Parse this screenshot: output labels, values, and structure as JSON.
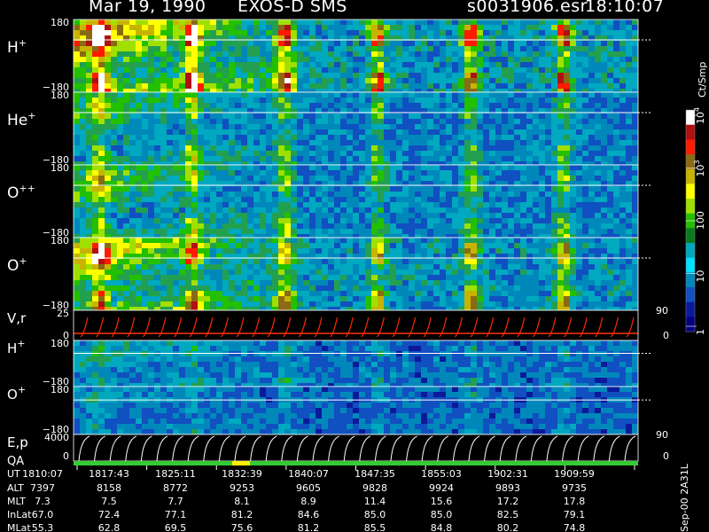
{
  "header": {
    "date": "Mar 19, 1990",
    "mission": "EXOS-D SMS",
    "file": "s0031906.esr",
    "time": "18:10:07"
  },
  "side_label": "Sep-00  2A31L",
  "colorbar": {
    "unit": "Ct/Smp",
    "ticks": [
      {
        "label": "10",
        "sup": "4",
        "value": 10000
      },
      {
        "label": "10",
        "sup": "3",
        "value": 1000
      },
      {
        "label": "100",
        "sup": "",
        "value": 100
      },
      {
        "label": "10",
        "sup": "",
        "value": 10
      },
      {
        "label": "1",
        "sup": "",
        "value": 1
      }
    ],
    "colors": [
      "#ffffff",
      "#b01010",
      "#ff1a00",
      "#8a6a14",
      "#c8b400",
      "#ffff00",
      "#a0e000",
      "#22c000",
      "#0a7a20",
      "#00a8c0",
      "#00e0ff",
      "#0088bb",
      "#1050c0",
      "#0a1a9a",
      "#000080"
    ]
  },
  "panels": [
    {
      "id": "hplus-ang",
      "label": "H",
      "sup": "+",
      "ymax": "180",
      "ymin": "−180",
      "intensity": 1.0
    },
    {
      "id": "heplus-ang",
      "label": "He",
      "sup": "+",
      "ymax": "180",
      "ymin": "−180",
      "intensity": 0.55
    },
    {
      "id": "oplusplus-ang",
      "label": "O",
      "sup": "++",
      "ymax": "180",
      "ymin": "−180",
      "intensity": 0.6
    },
    {
      "id": "oplus-ang",
      "label": "O",
      "sup": "+",
      "ymax": "180",
      "ymin": "−180",
      "intensity": 0.85
    },
    {
      "id": "vr",
      "label": "V",
      "sup": "",
      "label2": ",r",
      "ymax": "25",
      "ymin": "0",
      "right_top": "90",
      "right_bottom": "0"
    },
    {
      "id": "hplus-2",
      "label": "H",
      "sup": "+",
      "ymax": "180",
      "ymin": "−180",
      "intensity": 0.35
    },
    {
      "id": "oplus-2",
      "label": "O",
      "sup": "+",
      "ymax": "180",
      "ymin": "−180",
      "intensity": 0.25
    },
    {
      "id": "ep",
      "label": "E,p",
      "sup": "",
      "ymax": "4000",
      "ymin": "0",
      "right_top": "90",
      "right_bottom": "0"
    }
  ],
  "qa_label": "QA",
  "footer": {
    "rows": [
      {
        "name": "UT",
        "values": [
          "1810:07",
          "1817:43",
          "1825:11",
          "1832:39",
          "1840:07",
          "1847:35",
          "1855:03",
          "1902:31",
          "1909:59"
        ]
      },
      {
        "name": "ALT",
        "values": [
          "7397",
          "8158",
          "8772",
          "9253",
          "9605",
          "9828",
          "9924",
          "9893",
          "9735"
        ]
      },
      {
        "name": "MLT",
        "values": [
          "7.3",
          "7.5",
          "7.7",
          "8.1",
          "8.9",
          "11.4",
          "15.6",
          "17.2",
          "17.8"
        ]
      },
      {
        "name": "InLat",
        "values": [
          "67.0",
          "72.4",
          "77.1",
          "81.2",
          "84.6",
          "85.0",
          "85.0",
          "82.5",
          "79.1"
        ]
      },
      {
        "name": "MLat",
        "values": [
          "55.3",
          "62.8",
          "69.5",
          "75.6",
          "81.2",
          "85.5",
          "84.8",
          "80.2",
          "74.8"
        ]
      }
    ]
  },
  "chart_data": {
    "type": "heatmap",
    "title": "Mar 19, 1990   EXOS-D SMS",
    "x": [
      "1810:07",
      "1817:43",
      "1825:11",
      "1832:39",
      "1840:07",
      "1847:35",
      "1855:03",
      "1902:31",
      "1909:59"
    ],
    "series": [
      {
        "name": "H+",
        "ylim": [
          -180,
          180
        ]
      },
      {
        "name": "He+",
        "ylim": [
          -180,
          180
        ]
      },
      {
        "name": "O++",
        "ylim": [
          -180,
          180
        ]
      },
      {
        "name": "O+",
        "ylim": [
          -180,
          180
        ]
      },
      {
        "name": "V,r",
        "ylim": [
          0,
          25
        ]
      },
      {
        "name": "H+",
        "ylim": [
          -180,
          180
        ]
      },
      {
        "name": "O+",
        "ylim": [
          -180,
          180
        ]
      },
      {
        "name": "E,p",
        "ylim": [
          0,
          4000
        ]
      }
    ],
    "colorbar_range": [
      1,
      10000
    ],
    "colorbar_unit": "Ct/Smp"
  }
}
